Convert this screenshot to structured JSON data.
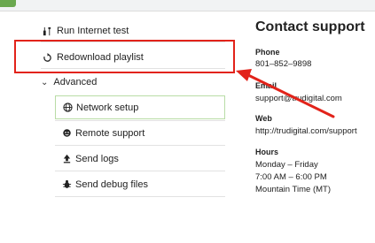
{
  "menu": {
    "run_test": "Run Internet test",
    "redownload": "Redownload playlist",
    "advanced": "Advanced",
    "sub_items": [
      {
        "label": "Network setup"
      },
      {
        "label": "Remote support"
      },
      {
        "label": "Send logs"
      },
      {
        "label": "Send debug files"
      }
    ]
  },
  "contact": {
    "title": "Contact support",
    "phone_label": "Phone",
    "phone": "801–852–9898",
    "email_label": "Email",
    "email": "support@trudigital.com",
    "web_label": "Web",
    "web": "http://trudigital.com/support",
    "hours_label": "Hours",
    "hours_days": "Monday – Friday",
    "hours_time": "7:00 AM – 6:00 PM",
    "hours_zone": "Mountain Time (MT)"
  },
  "icons": {
    "run_test": "tools-icon",
    "redownload": "refresh-icon",
    "advanced": "chevron-down-icon",
    "network": "globe-icon",
    "remote": "support-agent-icon",
    "logs": "upload-icon",
    "debug": "bug-icon"
  },
  "colors": {
    "highlight": "#e2231a",
    "active_border": "#b9dca6",
    "brand_chip": "#6aa84f"
  }
}
